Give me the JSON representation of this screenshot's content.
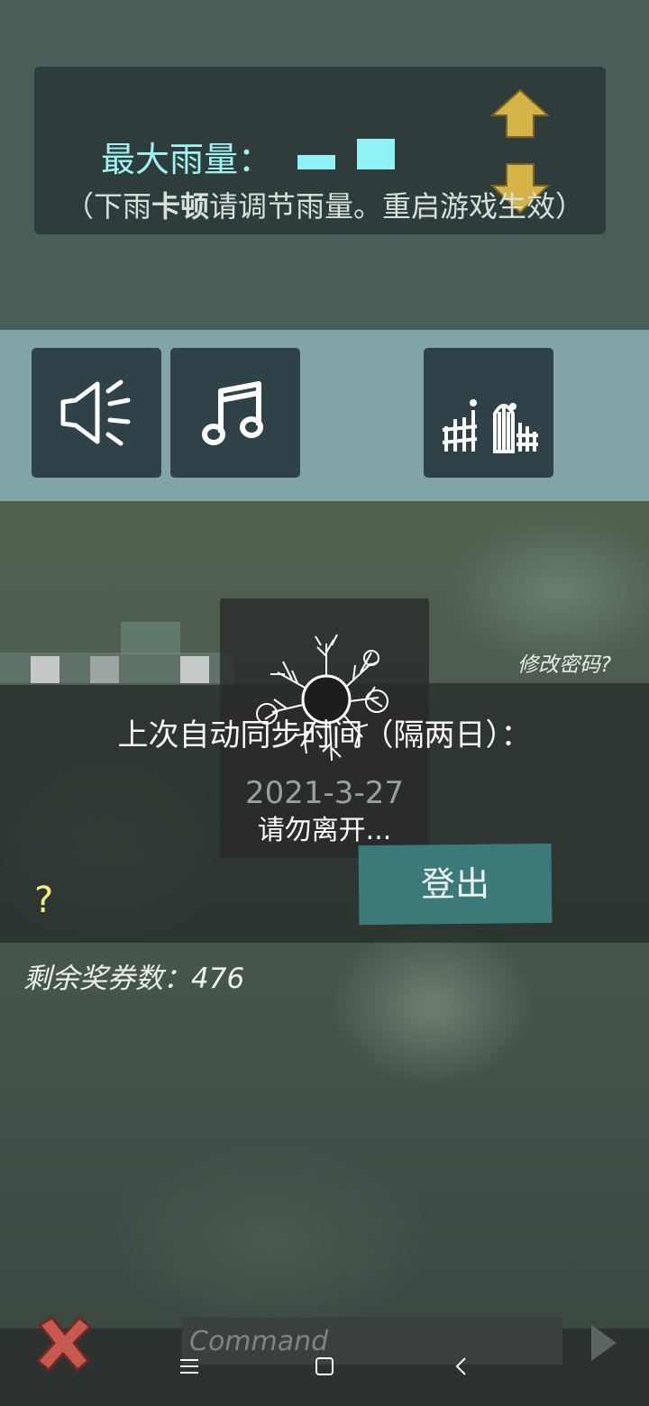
{
  "rain_settings": {
    "label": "最大雨量：",
    "hint_open": "（下雨",
    "hint_bold": "卡顿",
    "hint_rest": "请调节雨量。重启游戏生效）",
    "increase_icon": "arrow-up-icon",
    "decrease_icon": "arrow-down-icon"
  },
  "toolbar": {
    "buttons": [
      {
        "icon": "speaker-icon"
      },
      {
        "icon": "music-note-icon"
      },
      {
        "icon": "fence-gate-icon"
      }
    ]
  },
  "account": {
    "change_password": "修改密码?",
    "sync_label": "上次自动同步时间（隔两日）：",
    "sync_date": "2021-3-27",
    "logout_label": "登出",
    "help_label": "?",
    "loading_text": "请勿离开..."
  },
  "tickets": {
    "label": "剩余奖券数：476"
  },
  "command_bar": {
    "placeholder": "Command",
    "close_icon": "close-x-icon",
    "send_icon": "send-arrow-icon"
  },
  "system_nav": {
    "menu_icon": "menu-icon",
    "home_icon": "home-icon",
    "back_icon": "back-icon"
  },
  "colors": {
    "accent_cyan": "#8ff2f4",
    "toolbar_bg": "#81a5a6",
    "button_bg": "#2e4247",
    "logout_bg": "#3c7a79",
    "arrow_gold": "#d4b445",
    "help_yellow": "#f4f07a"
  }
}
